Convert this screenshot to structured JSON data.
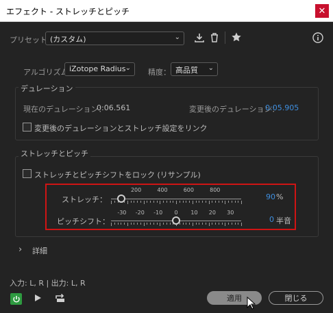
{
  "window": {
    "title": "エフェクト - ストレッチとピッチ",
    "close_glyph": "✕"
  },
  "preset": {
    "label": "プリセット：",
    "value": "(カスタム)",
    "save_icon": "download-icon",
    "delete_icon": "trash-icon",
    "favorite_icon": "star-icon",
    "info_icon": "info-icon"
  },
  "algorithm": {
    "label": "アルゴリズム：",
    "value": "iZotope Radius"
  },
  "precision": {
    "label": "精度：",
    "value": "高品質"
  },
  "duration": {
    "group_title": "デュレーション",
    "current_label": "現在のデュレーション：",
    "current_value": "0:06.561",
    "new_label": "変更後のデュレーション：",
    "new_value": "0:05.905",
    "link_checkbox_label": "変更後のデュレーションとストレッチ設定をリンク",
    "link_checked": false
  },
  "stretch_pitch": {
    "group_title": "ストレッチとピッチ",
    "lock_label": "ストレッチとピッチシフトをロック (リサンプル)",
    "lock_checked": false,
    "stretch": {
      "label": "ストレッチ：",
      "value": "90",
      "unit": "%",
      "ticks": [
        "200",
        "400",
        "600",
        "800"
      ],
      "min": 10,
      "max": 1000
    },
    "pitch": {
      "label": "ピッチシフト：",
      "value": "0",
      "unit": "半音",
      "ticks": [
        "-30",
        "-20",
        "-10",
        "0",
        "10",
        "20",
        "30"
      ],
      "min": -36,
      "max": 36
    }
  },
  "details": {
    "label": "詳細",
    "chevron": "›"
  },
  "io": {
    "label": "入力: L, R | 出力: L, R"
  },
  "footer": {
    "apply_label": "適用",
    "close_label": "閉じる",
    "power_icon": "power-icon",
    "play_icon": "play-icon",
    "loop_icon": "loop-icon"
  },
  "colors": {
    "accent_blue": "#3f8fe0",
    "power_green": "#2e9a40",
    "highlight_red": "#d01414",
    "apply_bg": "#8a8a8a"
  }
}
